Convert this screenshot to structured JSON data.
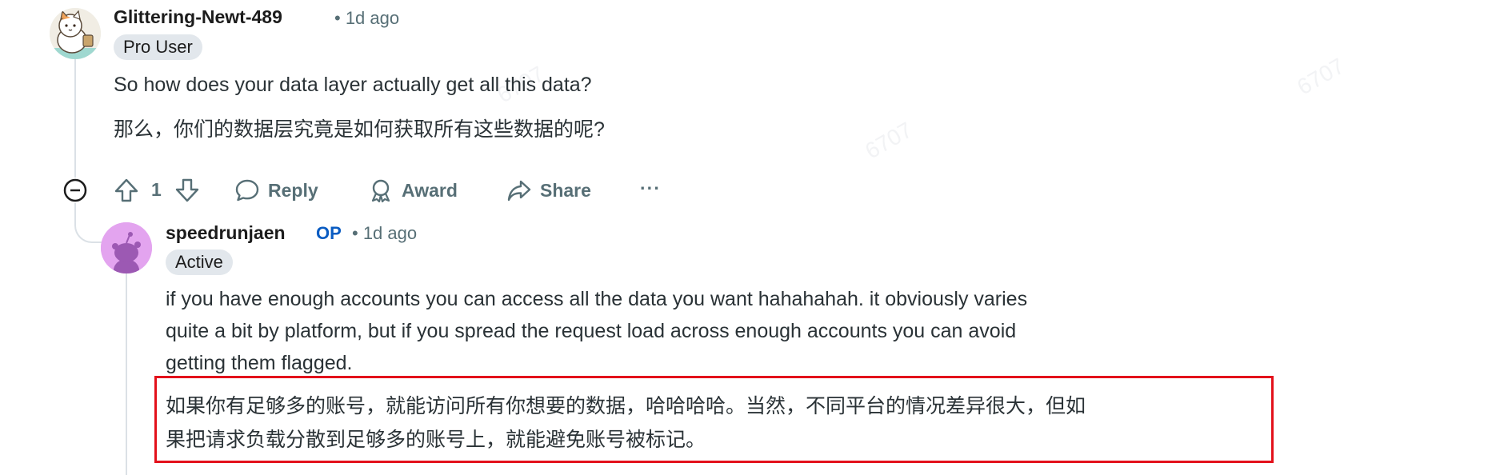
{
  "comment1": {
    "username": "Glittering-Newt-489",
    "timestamp": "• 1d ago",
    "flair": "Pro User",
    "text_en": "So how does your data layer actually get all this data?",
    "text_zh": "那么，你们的数据层究竟是如何获取所有这些数据的呢?",
    "vote_count": "1",
    "actions": {
      "reply": "Reply",
      "award": "Award",
      "share": "Share",
      "more": "···"
    }
  },
  "comment2": {
    "username": "speedrunjaen",
    "op_badge": "OP",
    "timestamp": "• 1d ago",
    "flair": "Active",
    "text_en_lines": [
      "if you have enough accounts you can access all the data you want hahahahah. it obviously varies",
      "quite a bit by platform, but if you spread the request load across enough accounts you can avoid",
      "getting them flagged."
    ],
    "text_zh_lines": [
      "如果你有足够多的账号，就能访问所有你想要的数据，哈哈哈哈。当然，不同平台的情况差异很大，但如",
      "果把请求负载分散到足够多的账号上，就能避免账号被标记。"
    ]
  },
  "colors": {
    "accent_op": "#0a5cc2",
    "highlight_border": "#e3111b",
    "flair_bg": "#e2e7ec",
    "meta_text": "#576f76"
  },
  "icons": [
    "collapse-icon",
    "upvote-icon",
    "downvote-icon",
    "reply-icon",
    "award-icon",
    "share-icon",
    "more-icon"
  ]
}
